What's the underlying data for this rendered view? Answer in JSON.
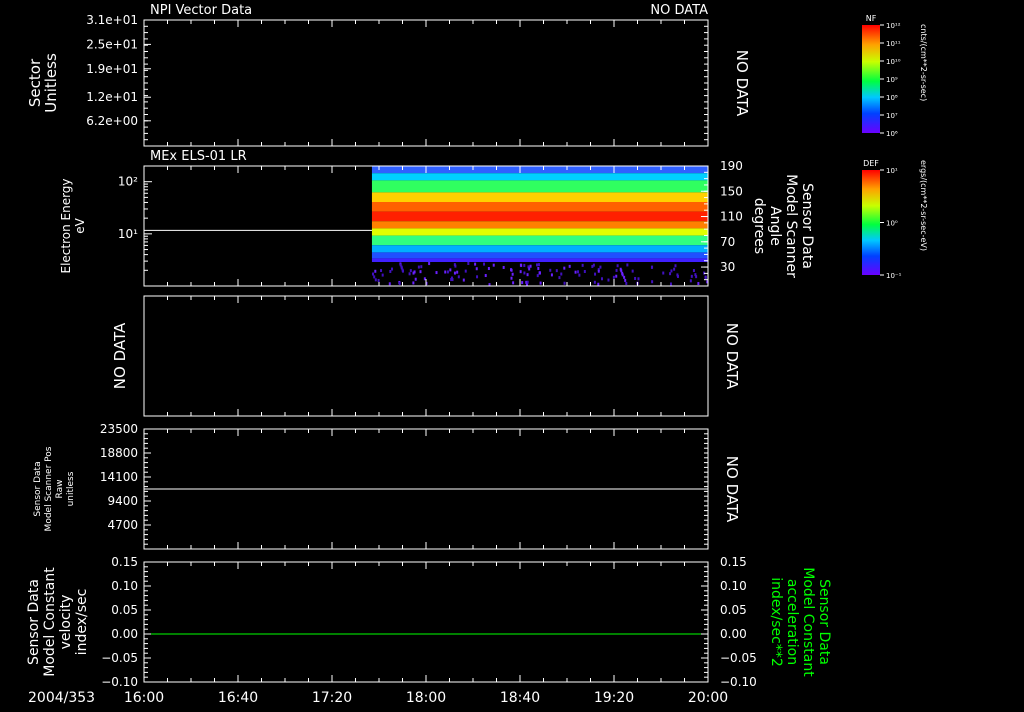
{
  "date_label": "2004/353",
  "time_ticks": [
    "16:00",
    "16:40",
    "17:20",
    "18:00",
    "18:40",
    "19:20",
    "20:00"
  ],
  "chart_data": [
    {
      "type": "heatmap",
      "title": "NPI Vector Data",
      "status": "NO DATA",
      "ylabel": [
        "Sector",
        "Unitless"
      ],
      "right_label": "NO DATA",
      "ylim": [
        0,
        31
      ],
      "ytick_labels": [
        "3.1e+01",
        "2.5e+01",
        "1.9e+01",
        "1.2e+01",
        "6.2e+00"
      ],
      "ytick_values": [
        31,
        25,
        19,
        12,
        6.2
      ],
      "colorbar": {
        "label": "NF",
        "unit": "cnts/(cm**2-sr-sec)",
        "ticks": [
          "10¹²",
          "10¹¹",
          "10¹⁰",
          "10⁹",
          "10⁸",
          "10⁷",
          "10⁶"
        ]
      }
    },
    {
      "type": "heatmap",
      "title": "MEx ELS-01 LR",
      "ylabel": [
        "Electron Energy",
        "eV"
      ],
      "ylim": [
        1,
        200
      ],
      "yscale": "log",
      "ytick_labels": [
        "10²",
        "10¹"
      ],
      "ytick_values": [
        100,
        10
      ],
      "right_axis": {
        "labels": [
          "Sensor Data",
          "Model Scanner",
          "Angle",
          "degrees"
        ],
        "ylim": [
          0,
          190
        ],
        "tick_labels": [
          "190",
          "150",
          "110",
          "70",
          "30"
        ],
        "tick_values": [
          190,
          150,
          110,
          70,
          30
        ]
      },
      "data_start_time": "17:37",
      "data_end_time": "20:00",
      "angle_line_value": 88,
      "colorbar": {
        "label": "DEF",
        "unit": "ergs/(cm**2-sr-sec-eV)",
        "ticks": [
          "10¹",
          "10⁰",
          "10⁻¹"
        ]
      }
    },
    {
      "type": "line",
      "ylabel": [
        "NO DATA"
      ],
      "right_label": "NO DATA"
    },
    {
      "type": "line",
      "ylabel": [
        "Sensor Data",
        "Model Scanner Pos",
        "Raw",
        "unitless"
      ],
      "right_label": "NO DATA",
      "ylim": [
        0,
        23500
      ],
      "ytick_labels": [
        "23500",
        "18800",
        "14100",
        "9400",
        "4700"
      ],
      "ytick_values": [
        23500,
        18800,
        14100,
        9400,
        4700
      ],
      "series": [
        {
          "values": [
            11750,
            11750
          ]
        }
      ]
    },
    {
      "type": "line",
      "ylabel": [
        "Sensor Data",
        "Model Constant",
        "velocity",
        "index/sec"
      ],
      "ylim": [
        -0.1,
        0.15
      ],
      "ytick_labels": [
        "0.15",
        "0.10",
        "0.05",
        "0.00",
        "−0.05",
        "−0.10"
      ],
      "ytick_values": [
        0.15,
        0.1,
        0.05,
        0.0,
        -0.05,
        -0.1
      ],
      "right_axis": {
        "labels": [
          "Sensor Data",
          "Model Constant",
          "acceleration",
          "index/sec**2"
        ],
        "color": "#00ff00",
        "tick_labels": [
          "0.15",
          "0.10",
          "0.05",
          "0.00",
          "−0.05",
          "−0.10"
        ]
      },
      "series": [
        {
          "values": [
            0.0,
            0.0
          ],
          "color": "#00ff00"
        }
      ]
    }
  ]
}
